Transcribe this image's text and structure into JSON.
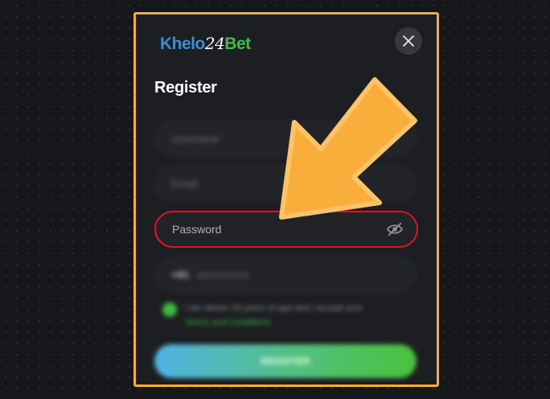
{
  "logo": {
    "part1": "Khelo",
    "part2": "24",
    "part3": "Bet"
  },
  "modal": {
    "title": "Register"
  },
  "form": {
    "username_placeholder": "Username",
    "email_placeholder": "Email",
    "password_placeholder": "Password",
    "phone_code": "+91",
    "phone_placeholder": "xxxxxxxxxx",
    "terms_text": "I am above 18 years of age and I accept your",
    "terms_link": "Terms and Conditions",
    "register_label": "REGISTER"
  },
  "icons": [
    "close-icon",
    "eye-slash-icon",
    "arrow-pointer-icon",
    "checkbox-checked-icon"
  ],
  "colors": {
    "highlight_border": "#f6ad3a",
    "password_outline": "#e0141c",
    "accent_green": "#3dbb3f",
    "arrow": "#f9ae3b"
  }
}
